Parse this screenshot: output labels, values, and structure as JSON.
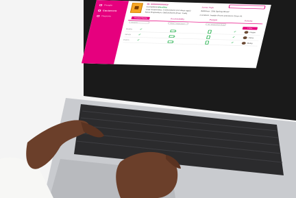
{
  "sidebar": {
    "items": [
      {
        "label": "People",
        "icon": "people-icon"
      },
      {
        "label": "Equipment",
        "icon": "equipment-icon",
        "active": true
      },
      {
        "label": "Reports",
        "icon": "reports-icon"
      }
    ]
  },
  "equipment": {
    "id": "ID: 0000000000012",
    "compliance_label": "Compliance:",
    "compliance_value": "Healthy",
    "last_inspection": "Last Inspection: 01/02/2023 (14 days ago)",
    "next_expiration": "Next Expiration: 06/02/2023 (Due: 1wk)",
    "owner": "Jamie High",
    "address": "Address: 258 Spring Road",
    "location": "Location: Inside Front entrance Door #1"
  },
  "tabs": [
    "Inspections",
    "Accessibility",
    "People",
    "Activity"
  ],
  "filters": {
    "search_placeholder": "Search",
    "date_placeholder": "Start: Inspection",
    "range_placeholder": "To: Inspection Date",
    "filter_button": "Filter"
  },
  "rows": [
    {
      "label": "Bottle",
      "person": "Hope"
    },
    {
      "label": "Stock",
      "person": "Jane"
    },
    {
      "label": "Extra",
      "person": "Ruby"
    }
  ],
  "colors": {
    "brand": "#e6007e",
    "status_ok": "#22b14c"
  }
}
